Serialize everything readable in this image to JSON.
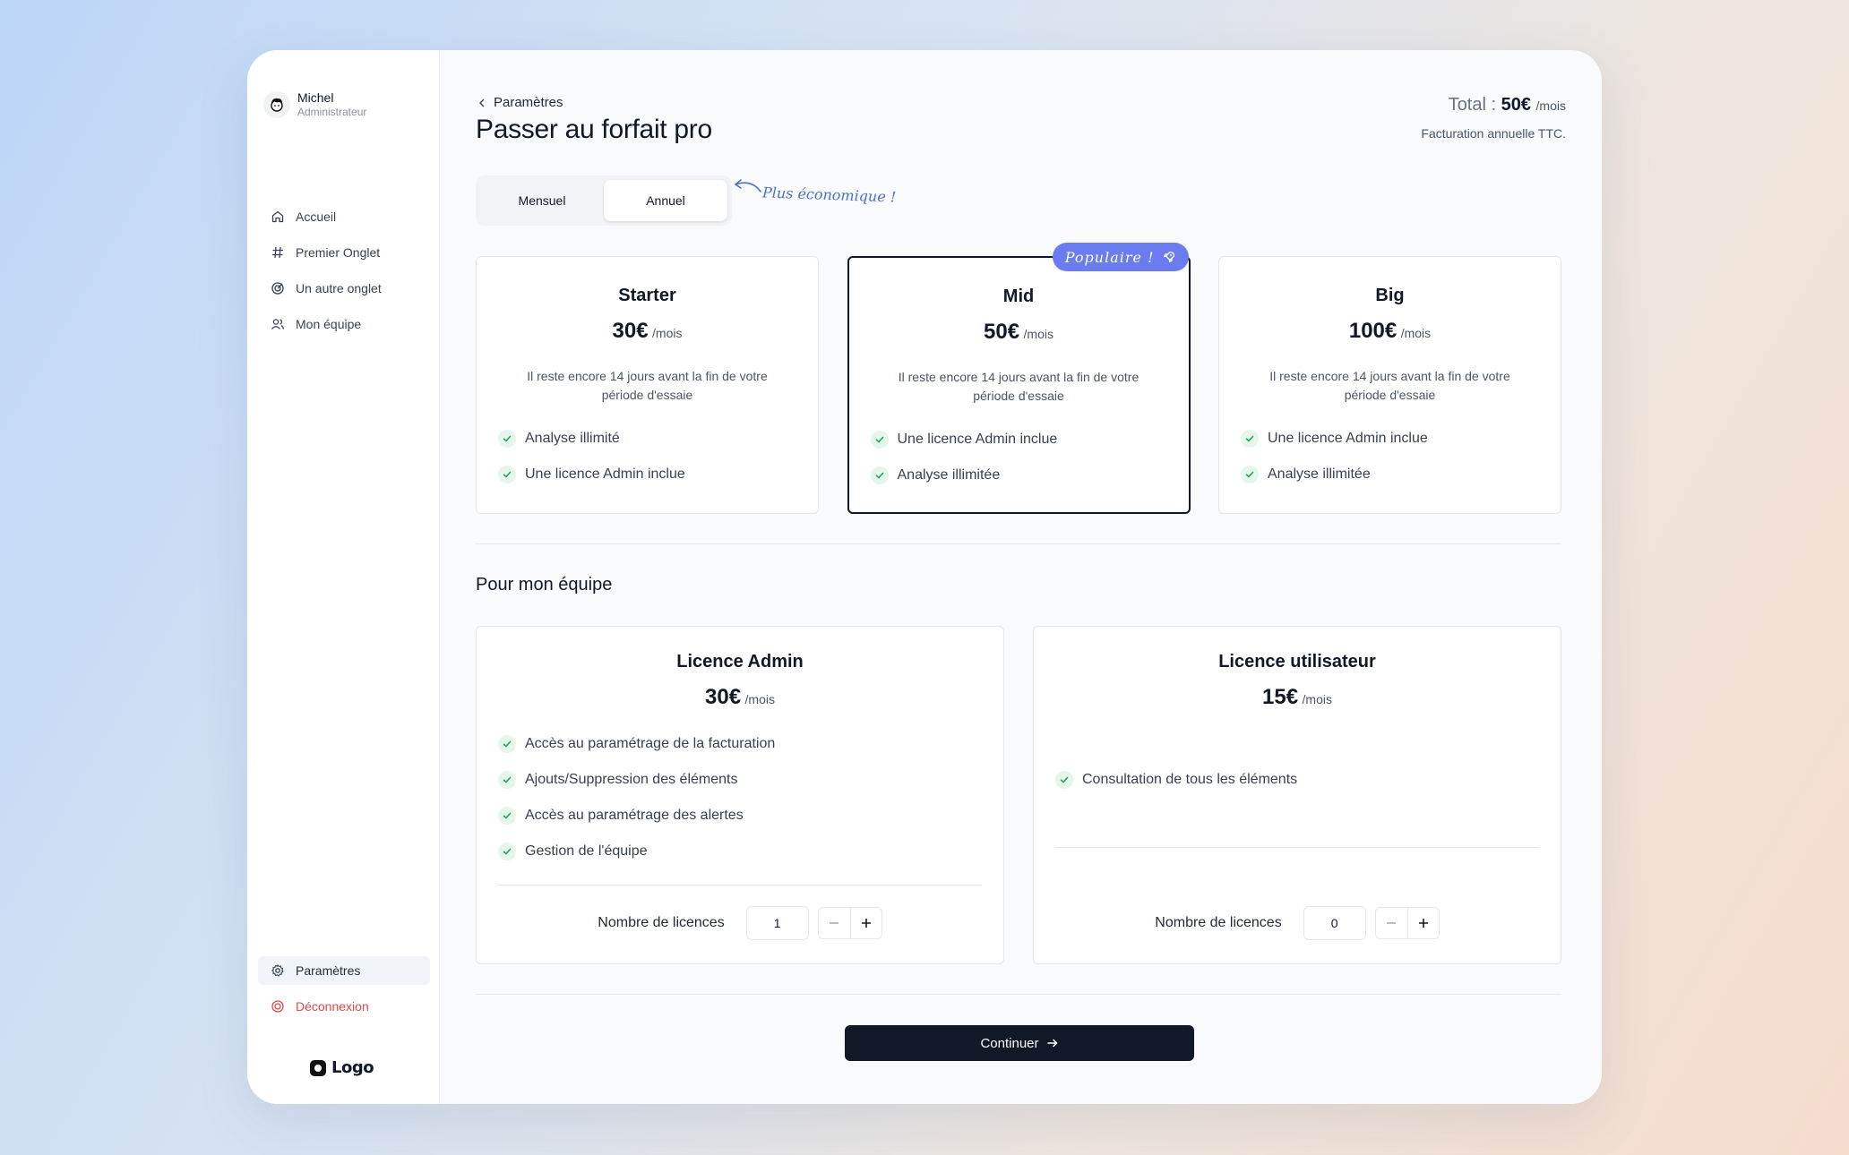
{
  "sidebar": {
    "user": {
      "name": "Michel",
      "role": "Administrateur"
    },
    "nav": [
      {
        "label": "Accueil",
        "icon": "home-icon"
      },
      {
        "label": "Premier Onglet",
        "icon": "hash-icon"
      },
      {
        "label": "Un autre onglet",
        "icon": "target-icon"
      },
      {
        "label": "Mon équipe",
        "icon": "users-icon"
      }
    ],
    "bottom": [
      {
        "label": "Paramètres",
        "icon": "gear-icon"
      },
      {
        "label": "Déconnexion",
        "icon": "logout-icon"
      }
    ],
    "logo_text": "Logo"
  },
  "header": {
    "breadcrumb": "Paramètres",
    "title": "Passer au forfait pro",
    "total_label": "Total :",
    "total_amount": "50€",
    "total_unit": "/mois",
    "billing_note": "Facturation annuelle TTC."
  },
  "billing_toggle": {
    "options": [
      "Mensuel",
      "Annuel"
    ],
    "selected": "Annuel",
    "annotation": "Plus économique !"
  },
  "plans": [
    {
      "name": "Starter",
      "price": "30€",
      "unit": "/mois",
      "description": "Il reste encore 14 jours avant la fin de votre période d'essaie",
      "features": [
        "Analyse illimité",
        "Une licence Admin inclue"
      ]
    },
    {
      "name": "Mid",
      "price": "50€",
      "unit": "/mois",
      "badge": "Populaire !",
      "description": "Il reste encore 14 jours avant la fin de votre période d'essaie",
      "features": [
        "Une licence Admin inclue",
        "Analyse illimitée"
      ]
    },
    {
      "name": "Big",
      "price": "100€",
      "unit": "/mois",
      "description": "Il reste encore 14 jours avant la fin de votre période d'essaie",
      "features": [
        "Une licence Admin inclue",
        "Analyse illimitée"
      ]
    }
  ],
  "team": {
    "title": "Pour mon équipe",
    "licenses": [
      {
        "name": "Licence Admin",
        "price": "30€",
        "unit": "/mois",
        "features": [
          "Accès au paramétrage de la facturation",
          "Ajouts/Suppression des éléments",
          "Accès au paramétrage des alertes",
          "Gestion de l'équipe"
        ],
        "count_label": "Nombre de licences",
        "count": "1"
      },
      {
        "name": "Licence utilisateur",
        "price": "15€",
        "unit": "/mois",
        "features": [
          "Consultation de tous les éléments"
        ],
        "count_label": "Nombre de licences",
        "count": "0"
      }
    ]
  },
  "continue_label": "Continuer",
  "colors": {
    "accent": "#6b7cf0",
    "primary": "#111827",
    "danger": "#e0484d",
    "check": "#22a55a"
  }
}
